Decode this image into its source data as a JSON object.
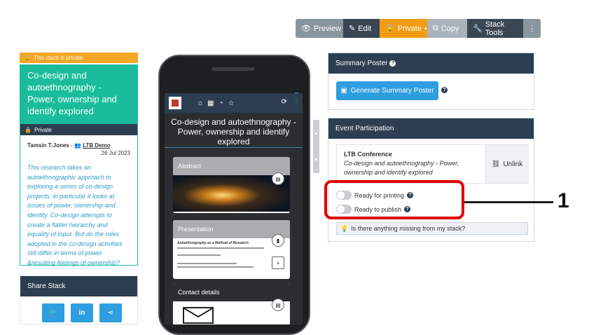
{
  "toolbar": {
    "preview": "Preview",
    "edit": "Edit",
    "private": "Private",
    "copy": "Copy",
    "stack_tools": "Stack Tools",
    "more": "⋮"
  },
  "stack": {
    "private_banner": "This stack is private",
    "title": "Co-design and autoethnography - Power, ownership and identify explored",
    "visibility": "Private",
    "author": "Tamsin T-Jones -",
    "group": "LTB Demo",
    "date": "26 Jul 2023",
    "description": "This research takes an autoethnographic approach to exploring a series of co-design projects. In particular it looks at issues of power, ownership and identity. Co-design attempts to create a flatter hierarchy and equality of input. But do the roles adopted in the co-design activities still differ in terms of power &resulting feelings of ownership?"
  },
  "share": {
    "title": "Share Stack"
  },
  "phone": {
    "title": "Co-design and autoethnography - Power, ownership and identify explored",
    "cards": [
      "Abstract",
      "Presentation",
      "Contact details"
    ],
    "doc_heading": "Autoethnography as a Method of Research"
  },
  "summary": {
    "title": "Summary Poster",
    "button": "Generate Summary Poster"
  },
  "event": {
    "title": "Event Participation",
    "conference": "LTB Conference",
    "stack_title": "Co-design and autoethnography - Power, ownership and identify explored",
    "unlink": "Unlink",
    "ready_printing": "Ready for printing",
    "ready_publish": "Ready to publish",
    "missing": "Is there anything missing from my stack?"
  },
  "annotation": {
    "label": "1"
  },
  "colors": {
    "accent": "#1abc9c",
    "private": "#f39c12",
    "navy": "#2c3e50",
    "button_blue": "#2e9ee0",
    "highlight": "#e00000"
  }
}
